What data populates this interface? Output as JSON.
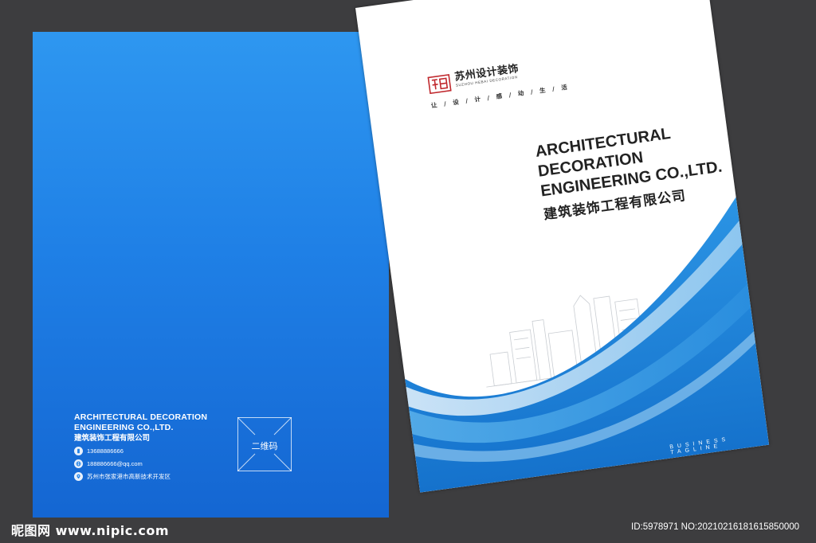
{
  "back_cover": {
    "company_en_line1": "ARCHITECTURAL DECORATION",
    "company_en_line2": "ENGINEERING CO.,LTD.",
    "company_cn": "建筑装饰工程有限公司",
    "phone": "13688886666",
    "email": "188886666@qq.com",
    "address": "苏州市张家港市高新技术开发区",
    "qr_label": "二维码",
    "icons": [
      "phone-icon",
      "globe-icon",
      "location-icon"
    ]
  },
  "front_cover": {
    "brand_cn": "苏州设计装饰",
    "brand_en": "SUZHOU HEBAI DECORATION",
    "slogan": "让 / 设 / 计 / 感 / 动 / 生 / 活",
    "title_line1": "ARCHITECTURAL",
    "title_line2": "DECORATION",
    "title_line3": "ENGINEERING CO.,LTD.",
    "title_cn": "建筑装饰工程有限公司",
    "tagline": "BUSINESS TAGLINE"
  },
  "watermark": {
    "left": "昵图网 www.nipic.com",
    "right": "ID:5978971 NO:20210216181615850000"
  },
  "colors": {
    "background": "#3d3d3f",
    "cover_blue": "#1f80e6",
    "wave_blue": "#1f86dc",
    "title_text": "#222222"
  }
}
